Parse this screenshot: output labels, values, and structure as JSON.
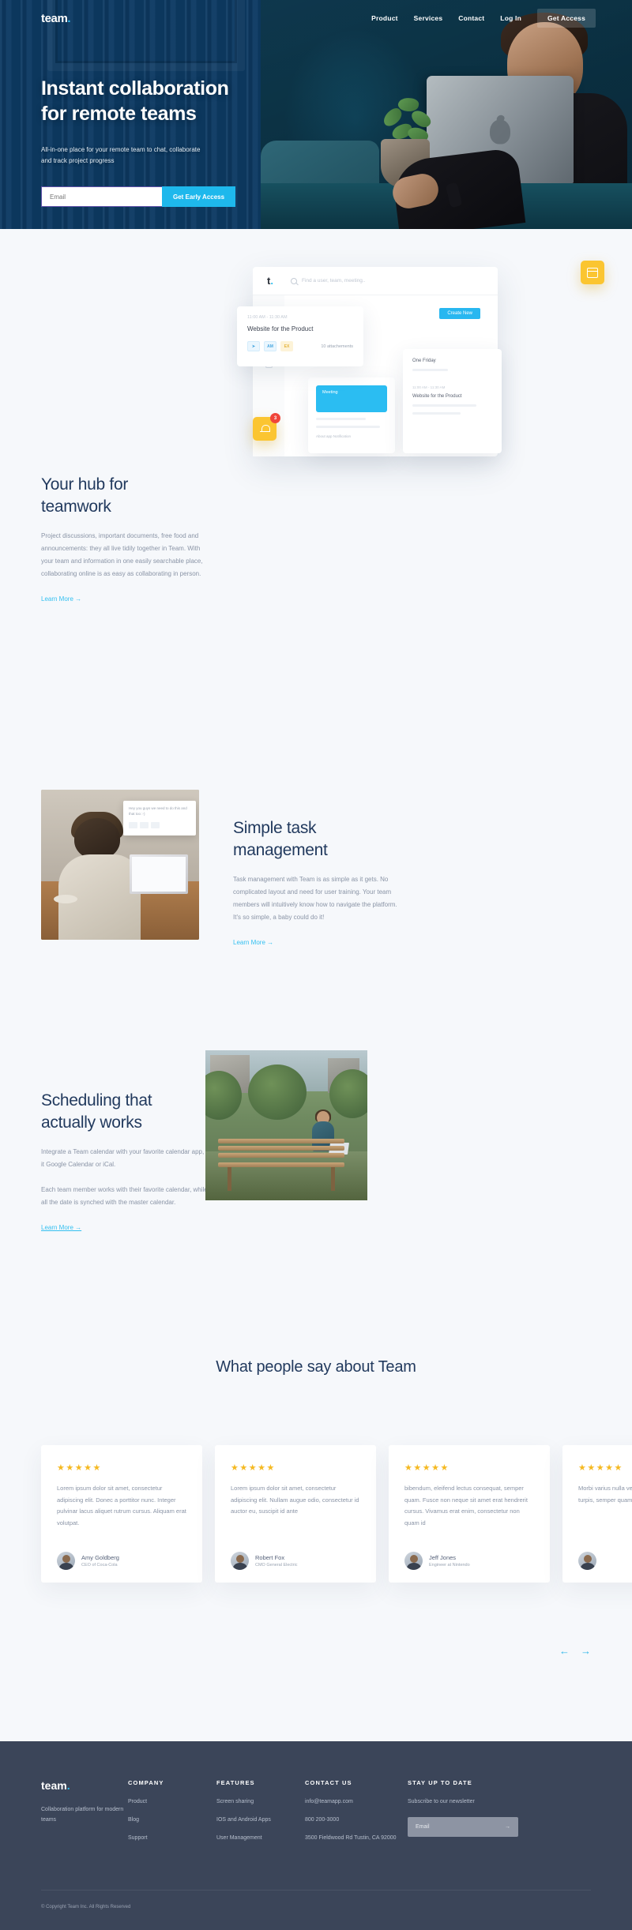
{
  "nav": {
    "logo": "team",
    "logo_dot": ".",
    "links": [
      "Product",
      "Services",
      "Contact",
      "Log In"
    ],
    "cta": "Get Access"
  },
  "hero": {
    "title_line1": "Instant collaboration",
    "title_line2": "for remote teams",
    "subtitle": "All-in-one place for your remote team to chat, collaborate and track project progress",
    "email_placeholder": "Email",
    "button": "Get Early Access"
  },
  "hub": {
    "title_line1": "Your hub for",
    "title_line2": "teamwork",
    "body": "Project discussions, important documents, free food and announcements: they all live tidily together in Team. With your team and information in one easily searchable place, collaborating online is as easy as collaborating in person.",
    "link": "Learn More  →"
  },
  "mockup": {
    "logo": "t",
    "logo_dot": ".",
    "search_placeholder": "Find a user, team, meeting..",
    "heading": "Meeting",
    "blue_button": "Create New",
    "card_time": "11:00 AM - 11:30 AM",
    "card_title": "Website for the Product",
    "chip1": "AM",
    "chip2": "EX",
    "attachments": "10 attachements",
    "teal_text": "Meeting",
    "inner_label": "About app Notification",
    "side_title": "One Friday",
    "side_item": "Website for the Product",
    "calendar_icon": "calendar-icon",
    "bell_icon": "bell-icon",
    "bell_badge": "3"
  },
  "task": {
    "title_line1": "Simple task",
    "title_line2": "management",
    "body": "Task management with Team is as simple as it gets. No complicated layout and need for user training. Your team members will intuitively know how to navigate the platform. It's so simple, a baby could do it!",
    "link": "Learn More  →",
    "note_text": "Hey you guys we need to do this and that too :-)"
  },
  "schedule": {
    "title_line1": "Scheduling that",
    "title_line2": "actually works",
    "body1": "Integrate a Team calendar with your favorite calendar app, be it Google Calendar or iCal.",
    "body2": "Each team member works with their favorite calendar, while all the date is synched with the master calendar.",
    "link": "Learn More  →"
  },
  "testimonials": {
    "heading": "What people say about Team",
    "stars": "★★★★★",
    "prev_icon": "arrow-left-icon",
    "next_icon": "arrow-right-icon",
    "prev": "←",
    "next": "→",
    "cards": [
      {
        "text": "Lorem ipsum dolor sit amet, consectetur adipiscing elit. Donec a porttitor nunc. Integer pulvinar lacus aliquet rutrum cursus. Aliquam erat volutpat.",
        "name": "Amy Goldberg",
        "role": "CEO of Coca-Cola"
      },
      {
        "text": "Lorem ipsum dolor sit amet, consectetur adipiscing elit. Nullam augue odio, consectetur id auctor eu, suscipit id ante",
        "name": "Robert Fox",
        "role": "CMO General Electric"
      },
      {
        "text": "bibendum, eleifend lectus consequat, semper quam. Fusce non neque sit amet erat hendrerit cursus. Vivamus erat enim, consectetur non quam id",
        "name": "Jeff Jones",
        "role": "Engineer at Nintendo"
      },
      {
        "text": "Morbi varius nulla vel mi urna bibendum quam turpis, semper quam sed nulla elementum",
        "name": "",
        "role": ""
      }
    ]
  },
  "footer": {
    "logo": "team",
    "logo_dot": ".",
    "tagline": "Collaboration platform for modern teams",
    "columns": [
      {
        "heading": "COMPANY",
        "items": [
          "Product",
          "Blog",
          "Support"
        ]
      },
      {
        "heading": "FEATURES",
        "items": [
          "Screen sharing",
          "IOS and Android Apps",
          "User Management"
        ]
      },
      {
        "heading": "CONTACT US",
        "items": [
          "info@teamapp.com",
          "800 200-3000",
          "3500 Fieldwood Rd Tustin, CA 92000"
        ]
      }
    ],
    "newsletter": {
      "heading": "STAY UP TO DATE",
      "subtitle": "Subscribe to our newsletter",
      "placeholder": "Email",
      "arrow": "→"
    },
    "copyright": "© Copyright Team Inc. All Rights Reserved"
  }
}
